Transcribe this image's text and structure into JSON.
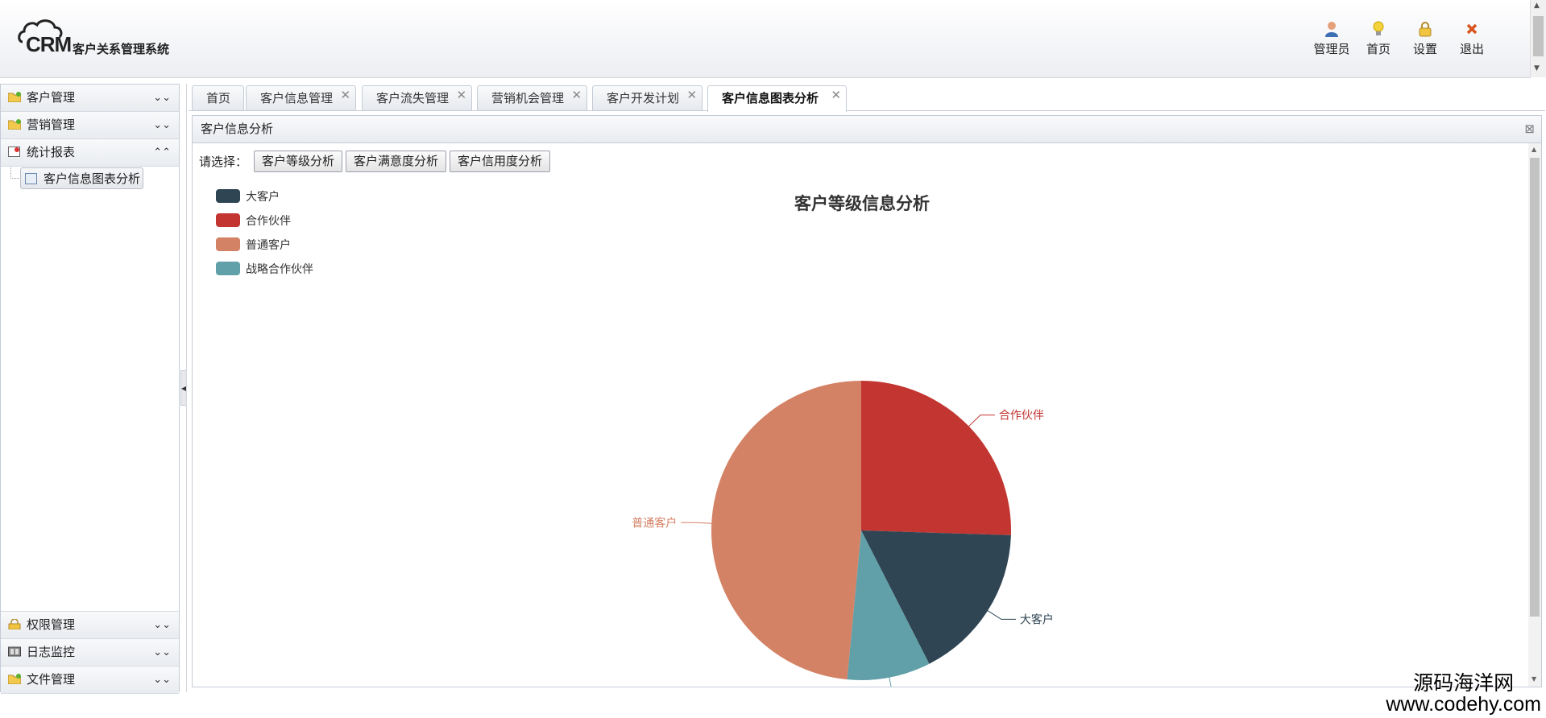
{
  "app": {
    "logo_text": "CRM",
    "title": "客户关系管理系统"
  },
  "header_buttons": [
    {
      "label": "管理员",
      "icon": "user-icon"
    },
    {
      "label": "首页",
      "icon": "lightbulb-icon"
    },
    {
      "label": "设置",
      "icon": "lock-icon"
    },
    {
      "label": "退出",
      "icon": "close-icon"
    }
  ],
  "sidebar": {
    "top_sections": [
      {
        "label": "客户管理",
        "icon": "folder-icon"
      },
      {
        "label": "营销管理",
        "icon": "folder-icon"
      },
      {
        "label": "统计报表",
        "icon": "report-icon"
      }
    ],
    "active_item": "客户信息图表分析",
    "bottom_sections": [
      {
        "label": "权限管理",
        "icon": "lock-icon"
      },
      {
        "label": "日志监控",
        "icon": "monitor-icon"
      },
      {
        "label": "文件管理",
        "icon": "folder-icon"
      }
    ]
  },
  "tabs": [
    {
      "label": "首页",
      "closable": false
    },
    {
      "label": "客户信息管理",
      "closable": true
    },
    {
      "label": "客户流失管理",
      "closable": true
    },
    {
      "label": "营销机会管理",
      "closable": true
    },
    {
      "label": "客户开发计划",
      "closable": true
    },
    {
      "label": "客户信息图表分析",
      "closable": true,
      "active": true
    }
  ],
  "tab_close_glyph": "✕",
  "panel": {
    "title": "客户信息分析",
    "select_label": "请选择：",
    "buttons": [
      "客户等级分析",
      "客户满意度分析",
      "客户信用度分析"
    ]
  },
  "chart_data": {
    "type": "pie",
    "title": "客户等级信息分析",
    "legend_position": "top-left",
    "series": [
      {
        "name": "合作伙伴",
        "value": 25.5,
        "color": "#c23531"
      },
      {
        "name": "大客户",
        "value": 17,
        "color": "#2f4554"
      },
      {
        "name": "战略合作伙伴",
        "value": 9,
        "color": "#61a0a8"
      },
      {
        "name": "普通客户",
        "value": 48.5,
        "color": "#d48265"
      }
    ],
    "legend_order": [
      "大客户",
      "合作伙伴",
      "普通客户",
      "战略合作伙伴"
    ]
  },
  "watermark": {
    "line1": "源码海洋网",
    "line2": "www.codehy.com"
  }
}
